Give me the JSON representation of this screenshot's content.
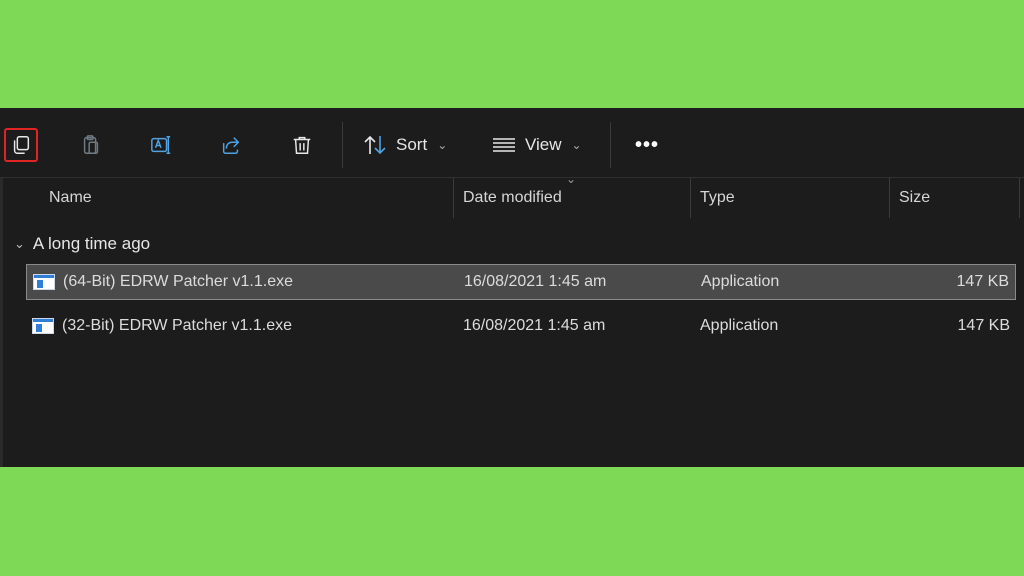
{
  "toolbar": {
    "icons": [
      "copy-icon",
      "paste-icon",
      "rename-icon",
      "share-icon",
      "delete-icon"
    ],
    "sort_label": "Sort",
    "view_label": "View",
    "more_label": "•••",
    "highlight_color": "#e02424"
  },
  "columns": {
    "name": "Name",
    "date": "Date modified",
    "type": "Type",
    "size": "Size"
  },
  "group": {
    "label": "A long time ago"
  },
  "files": [
    {
      "name": "(64-Bit) EDRW Patcher v1.1.exe",
      "date": "16/08/2021 1:45 am",
      "type": "Application",
      "size": "147 KB",
      "selected": true
    },
    {
      "name": "(32-Bit) EDRW Patcher v1.1.exe",
      "date": "16/08/2021 1:45 am",
      "type": "Application",
      "size": "147 KB",
      "selected": false
    }
  ],
  "colors": {
    "background": "#7ed957",
    "window": "#1c1c1c",
    "accent": "#4fa3e0"
  }
}
